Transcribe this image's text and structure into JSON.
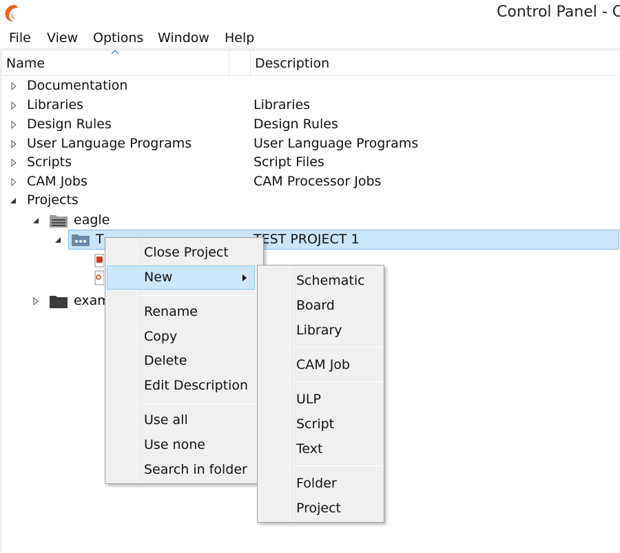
{
  "window": {
    "title": "Control Panel - C"
  },
  "menubar": {
    "items": [
      "File",
      "View",
      "Options",
      "Window",
      "Help"
    ]
  },
  "columns": {
    "name": "Name",
    "description": "Description"
  },
  "tree": {
    "items": [
      {
        "label": "Documentation",
        "description": ""
      },
      {
        "label": "Libraries",
        "description": "Libraries"
      },
      {
        "label": "Design Rules",
        "description": "Design Rules"
      },
      {
        "label": "User Language Programs",
        "description": "User Language Programs"
      },
      {
        "label": "Scripts",
        "description": "Script Files"
      },
      {
        "label": "CAM Jobs",
        "description": "CAM Processor Jobs"
      },
      {
        "label": "Projects",
        "description": ""
      }
    ],
    "eagle": {
      "label": "eagle"
    },
    "project": {
      "label": "T",
      "description": "TEST PROJECT 1"
    },
    "examples": {
      "label": "exam"
    }
  },
  "context_menu": {
    "close_project": "Close Project",
    "new": "New",
    "rename": "Rename",
    "copy": "Copy",
    "delete": "Delete",
    "edit_description": "Edit Description",
    "use_all": "Use all",
    "use_none": "Use none",
    "search_in_folder": "Search in folder"
  },
  "submenu": {
    "schematic": "Schematic",
    "board": "Board",
    "library": "Library",
    "cam_job": "CAM Job",
    "ulp": "ULP",
    "script": "Script",
    "text": "Text",
    "folder": "Folder",
    "project": "Project"
  },
  "colors": {
    "accent": "#cce4f7",
    "logo": "#e8641e",
    "folder": "#3a3a3a"
  }
}
